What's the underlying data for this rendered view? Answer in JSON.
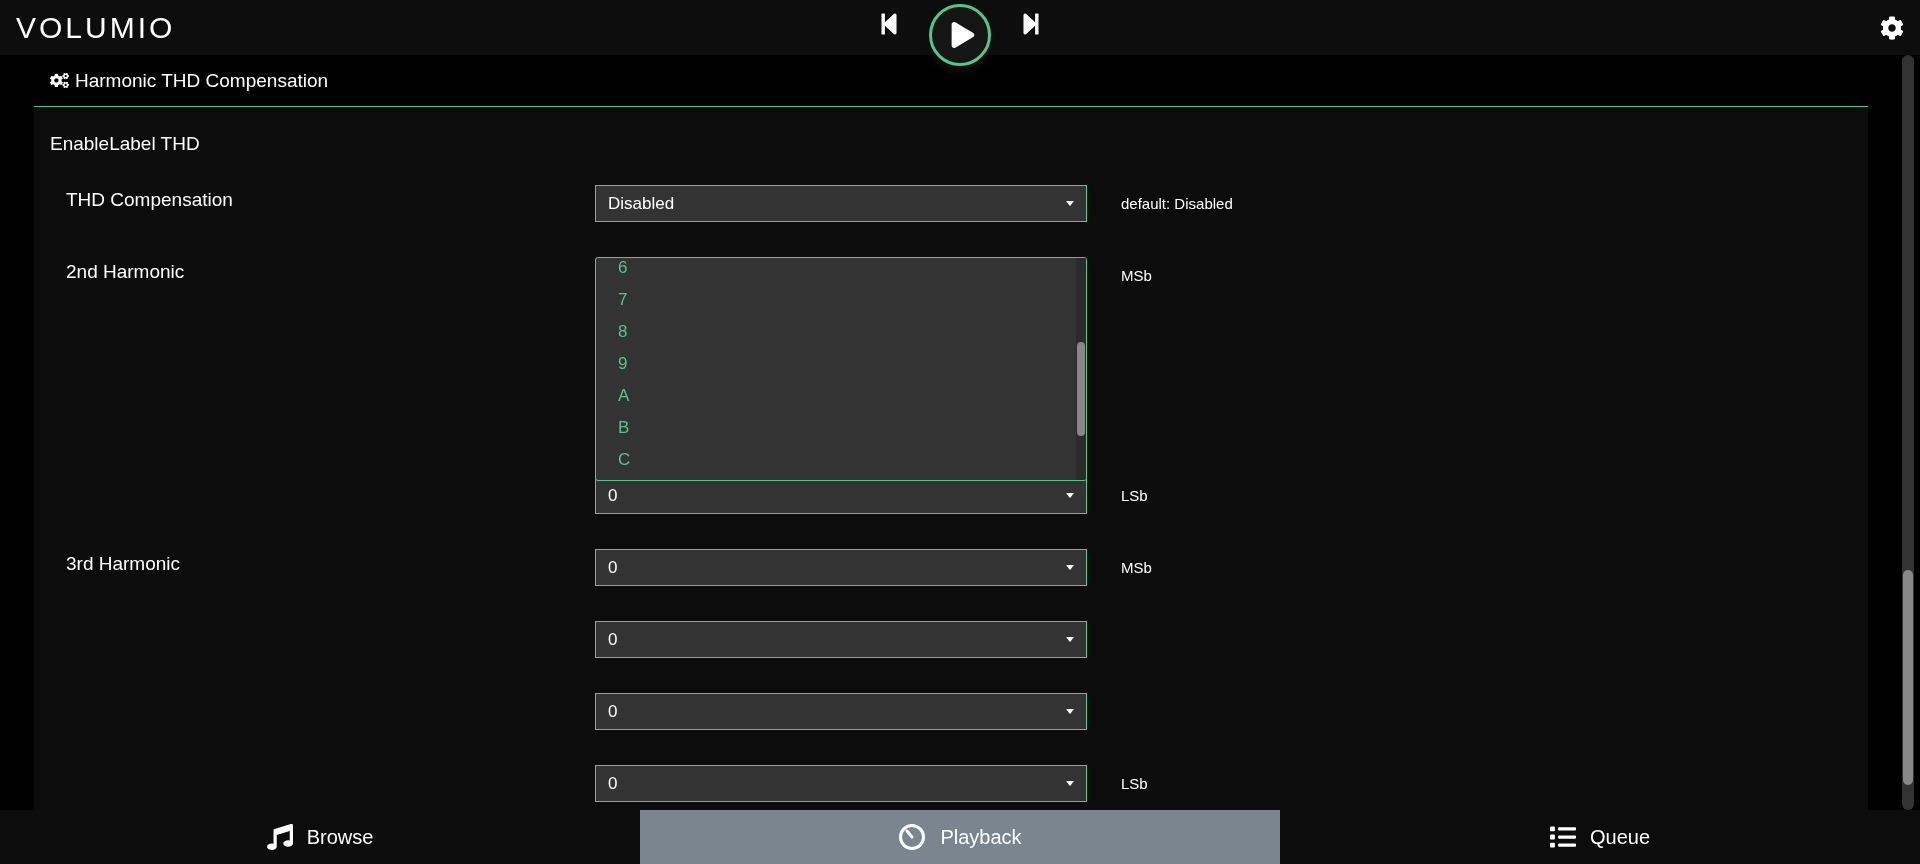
{
  "topbar": {
    "logo": "VOLUMIO"
  },
  "section": {
    "title": "Harmonic THD Compensation",
    "group_title": "EnableLabel THD",
    "rows": [
      {
        "kind": "select",
        "label": "THD Compensation",
        "controls": [
          {
            "value": "Disabled",
            "note": "default: Disabled"
          }
        ]
      },
      {
        "kind": "open_select",
        "label": "2nd Harmonic",
        "open_note": "MSb",
        "options": [
          "6",
          "7",
          "8",
          "9",
          "A",
          "B",
          "C"
        ],
        "controls": [
          {
            "value": "0",
            "note": "LSb"
          }
        ]
      },
      {
        "kind": "select",
        "label": "3rd Harmonic",
        "controls": [
          {
            "value": "0",
            "note": "MSb"
          },
          {
            "value": "0"
          },
          {
            "value": "0"
          },
          {
            "value": "0",
            "note": "LSb"
          }
        ]
      }
    ]
  },
  "bottom_tabs": [
    {
      "label": "Browse",
      "selected": false
    },
    {
      "label": "Playback",
      "selected": true
    },
    {
      "label": "Queue",
      "selected": false
    }
  ]
}
